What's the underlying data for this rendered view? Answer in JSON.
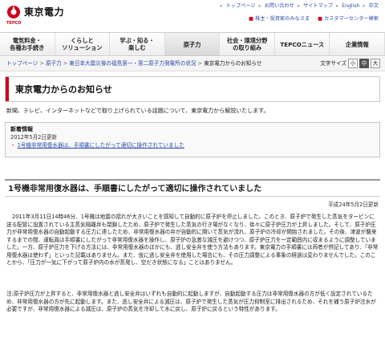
{
  "header": {
    "logo_text": "東京電力",
    "logo_sub": "TEPCO",
    "top_links": [
      "トップページ",
      "お問い合わせ",
      "サイトマップ",
      "English",
      "中文"
    ],
    "sub_links": [
      "株主・投資家のみなさま",
      "カスタマーセンター検索"
    ]
  },
  "nav": {
    "items": [
      "電気料金・\n各種お手続き",
      "くらしと\nソリューション",
      "学ぶ・知る・\n楽しむ",
      "原子力",
      "社会・環境分野\nの取り組み",
      "TEPCOニュース",
      "企業情報"
    ]
  },
  "breadcrumb": {
    "items": [
      "トップページ",
      "原子力",
      "東日本大震災後の福島第一・第二原子力発電所の状況",
      "東京電力からのお知らせ"
    ]
  },
  "textsize": {
    "label": "文字サイズ",
    "small": "小",
    "medium": "中",
    "large": "大"
  },
  "page": {
    "title": "東京電力からのお知らせ",
    "intro": "新聞、テレビ、インターネットなどで取り上げられている話題について、東京電力から解説いたします。"
  },
  "news": {
    "heading": "新着情報",
    "date": "2012年5月2日更新",
    "link": "1号機非常用復水器は、手順書にしたがって適切に操作されていました"
  },
  "article": {
    "title": "1号機非常用復水器は、手順書にしたがって適切に操作されていました",
    "date": "平成24年5月2日更新",
    "p1": "2011年3月11日14時46分、1号機は地震の揺れが大きいことを感知して自動的に原子炉を停止しました。このとき、原子炉で発生した蒸気をタービンに送る配管に設置されている主蒸気隔離弁も閉鎖したため、原子炉で発生した蒸気の行き場がなくなり、徐々に原子炉圧力が上昇しました。そして、原子炉圧力が非常用復水器の自動起動する圧力に達したため、非常用復水器の弁が自動的に開いて蒸気が流れ、原子炉の冷却が開始されました。その後、津波が襲来するまでの間、運転員は手順書にしたがって非常用復水器を操作し、原子炉の急激な減圧を避けつつ、原子炉圧力を一定範囲内に収まるように調整していました。一方、原子炉圧力を下げる方法には、非常用復水器のほかにも、逃し安全弁を使う方法もあります。東京電力の手順書には両者が併記してあり、「非常用復水器は使わず」といった記載はありません。また、仮に逃し安全弁を使用した場合にも、その圧力調整による事象の経過は変わりませんでした。このことから、「圧力が一気に下がって原子炉内の水が蒸発し、空だき状態になる」ことはありません。",
    "p2": "注:原子炉圧力が上昇すると、非常用復水器と逃し安全弁はいずれも自動的に起動しますが、自動起動する圧力は非常用復水器の方が低く設定されているため、非常用復水器の方が先に起動します。また、逃し安全弁による減圧は、原子炉で発生した蒸気が圧力抑制室に排出されるため、それを補う原子炉注水が必要ですが、非常用復水器による減圧は、原子炉の蒸気を冷却して水に戻し、原子炉に戻るという特性があります。"
  },
  "colors": {
    "brand_red": "#d0021b",
    "link_blue": "#2a4aa8"
  }
}
